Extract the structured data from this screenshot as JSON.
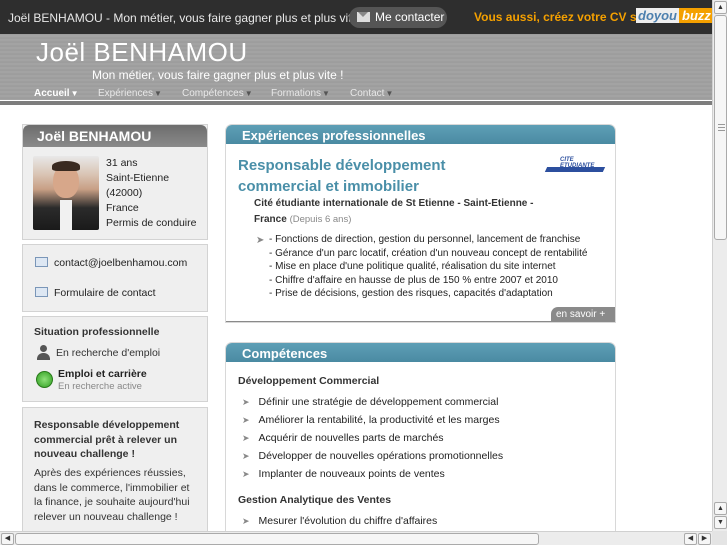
{
  "topbar": {
    "title": "Joël BENHAMOU - Mon métier, vous faire gagner plus et plus vite !",
    "contact_button": "Me contacter",
    "promo": "Vous aussi, créez votre CV sur",
    "logo_part1": "doyou",
    "logo_part2": "buzz"
  },
  "header": {
    "name": "Joël BENHAMOU",
    "tagline": "Mon métier, vous faire gagner plus et plus vite !"
  },
  "nav": [
    {
      "label": "Accueil",
      "active": true
    },
    {
      "label": "Expériences"
    },
    {
      "label": "Compétences"
    },
    {
      "label": "Formations"
    },
    {
      "label": "Contact"
    }
  ],
  "nav_caret": "▼",
  "profile": {
    "title": "Joël BENHAMOU",
    "age": "31 ans",
    "city": "Saint-Etienne",
    "postcode": "(42000)",
    "country": "France",
    "license": "Permis de conduire"
  },
  "contact": {
    "email": "contact@joelbenhamou.com",
    "form": "Formulaire de contact"
  },
  "situation": {
    "title": "Situation professionnelle",
    "status": "En recherche d'emploi",
    "badge_title": "Emploi et carrière",
    "badge_sub": "En recherche active"
  },
  "pitch": {
    "headline": "Responsable développement commercial prêt à relever un nouveau challenge !",
    "text": "Après des expériences réussies, dans le commerce, l'immobilier et la finance, je souhaite aujourd'hui relever un nouveau challenge !"
  },
  "experiences": {
    "title": "Expériences professionnelles",
    "job": "Responsable développement commercial et immobilier",
    "company_logo_text": "CITE ETUDIANTE",
    "company": "Cité étudiante internationale de St Etienne - Saint-Etienne - France",
    "since": "(Depuis 6 ans)",
    "duties": [
      "- Fonctions de direction, gestion du personnel, lancement de franchise",
      "- Gérance d'un parc locatif, création d'un nouveau concept de rentabilité",
      "- Mise en place d'une politique qualité, réalisation du site internet",
      "- Chiffre d'affaire en hausse de plus de 150 % entre 2007 et 2010",
      "- Prise de décisions, gestion des risques, capacités d'adaptation"
    ],
    "more": "en savoir +"
  },
  "competences": {
    "title": "Compétences",
    "sections": [
      {
        "name": "Développement Commercial",
        "items": [
          "Définir une stratégie de développement commercial",
          "Améliorer la rentabilité, la productivité et les marges",
          "Acquérir de nouvelles parts de marchés",
          "Développer de nouvelles opérations promotionnelles",
          "Implanter de nouveaux points de ventes"
        ]
      },
      {
        "name": "Gestion Analytique des Ventes",
        "items": [
          "Mesurer l'évolution du chiffre d'affaires"
        ]
      }
    ]
  },
  "bullet": "➤",
  "scroll": {
    "up": "▲",
    "down": "▼",
    "left": "◀",
    "right": "▶"
  }
}
